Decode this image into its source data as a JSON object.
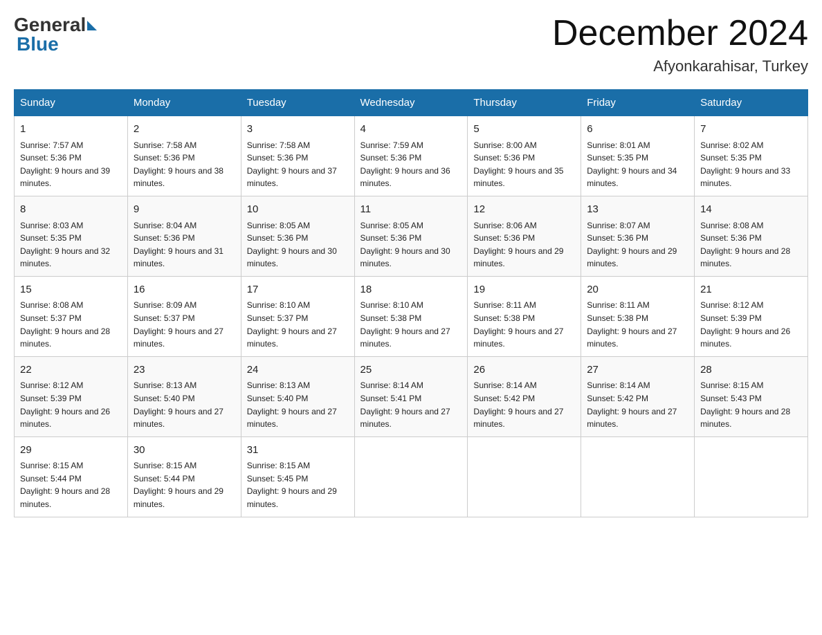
{
  "header": {
    "logo_general": "General",
    "logo_blue": "Blue",
    "month_year": "December 2024",
    "location": "Afyonkarahisar, Turkey"
  },
  "days_of_week": [
    "Sunday",
    "Monday",
    "Tuesday",
    "Wednesday",
    "Thursday",
    "Friday",
    "Saturday"
  ],
  "weeks": [
    [
      {
        "day": "1",
        "sunrise": "7:57 AM",
        "sunset": "5:36 PM",
        "daylight": "9 hours and 39 minutes."
      },
      {
        "day": "2",
        "sunrise": "7:58 AM",
        "sunset": "5:36 PM",
        "daylight": "9 hours and 38 minutes."
      },
      {
        "day": "3",
        "sunrise": "7:58 AM",
        "sunset": "5:36 PM",
        "daylight": "9 hours and 37 minutes."
      },
      {
        "day": "4",
        "sunrise": "7:59 AM",
        "sunset": "5:36 PM",
        "daylight": "9 hours and 36 minutes."
      },
      {
        "day": "5",
        "sunrise": "8:00 AM",
        "sunset": "5:36 PM",
        "daylight": "9 hours and 35 minutes."
      },
      {
        "day": "6",
        "sunrise": "8:01 AM",
        "sunset": "5:35 PM",
        "daylight": "9 hours and 34 minutes."
      },
      {
        "day": "7",
        "sunrise": "8:02 AM",
        "sunset": "5:35 PM",
        "daylight": "9 hours and 33 minutes."
      }
    ],
    [
      {
        "day": "8",
        "sunrise": "8:03 AM",
        "sunset": "5:35 PM",
        "daylight": "9 hours and 32 minutes."
      },
      {
        "day": "9",
        "sunrise": "8:04 AM",
        "sunset": "5:36 PM",
        "daylight": "9 hours and 31 minutes."
      },
      {
        "day": "10",
        "sunrise": "8:05 AM",
        "sunset": "5:36 PM",
        "daylight": "9 hours and 30 minutes."
      },
      {
        "day": "11",
        "sunrise": "8:05 AM",
        "sunset": "5:36 PM",
        "daylight": "9 hours and 30 minutes."
      },
      {
        "day": "12",
        "sunrise": "8:06 AM",
        "sunset": "5:36 PM",
        "daylight": "9 hours and 29 minutes."
      },
      {
        "day": "13",
        "sunrise": "8:07 AM",
        "sunset": "5:36 PM",
        "daylight": "9 hours and 29 minutes."
      },
      {
        "day": "14",
        "sunrise": "8:08 AM",
        "sunset": "5:36 PM",
        "daylight": "9 hours and 28 minutes."
      }
    ],
    [
      {
        "day": "15",
        "sunrise": "8:08 AM",
        "sunset": "5:37 PM",
        "daylight": "9 hours and 28 minutes."
      },
      {
        "day": "16",
        "sunrise": "8:09 AM",
        "sunset": "5:37 PM",
        "daylight": "9 hours and 27 minutes."
      },
      {
        "day": "17",
        "sunrise": "8:10 AM",
        "sunset": "5:37 PM",
        "daylight": "9 hours and 27 minutes."
      },
      {
        "day": "18",
        "sunrise": "8:10 AM",
        "sunset": "5:38 PM",
        "daylight": "9 hours and 27 minutes."
      },
      {
        "day": "19",
        "sunrise": "8:11 AM",
        "sunset": "5:38 PM",
        "daylight": "9 hours and 27 minutes."
      },
      {
        "day": "20",
        "sunrise": "8:11 AM",
        "sunset": "5:38 PM",
        "daylight": "9 hours and 27 minutes."
      },
      {
        "day": "21",
        "sunrise": "8:12 AM",
        "sunset": "5:39 PM",
        "daylight": "9 hours and 26 minutes."
      }
    ],
    [
      {
        "day": "22",
        "sunrise": "8:12 AM",
        "sunset": "5:39 PM",
        "daylight": "9 hours and 26 minutes."
      },
      {
        "day": "23",
        "sunrise": "8:13 AM",
        "sunset": "5:40 PM",
        "daylight": "9 hours and 27 minutes."
      },
      {
        "day": "24",
        "sunrise": "8:13 AM",
        "sunset": "5:40 PM",
        "daylight": "9 hours and 27 minutes."
      },
      {
        "day": "25",
        "sunrise": "8:14 AM",
        "sunset": "5:41 PM",
        "daylight": "9 hours and 27 minutes."
      },
      {
        "day": "26",
        "sunrise": "8:14 AM",
        "sunset": "5:42 PM",
        "daylight": "9 hours and 27 minutes."
      },
      {
        "day": "27",
        "sunrise": "8:14 AM",
        "sunset": "5:42 PM",
        "daylight": "9 hours and 27 minutes."
      },
      {
        "day": "28",
        "sunrise": "8:15 AM",
        "sunset": "5:43 PM",
        "daylight": "9 hours and 28 minutes."
      }
    ],
    [
      {
        "day": "29",
        "sunrise": "8:15 AM",
        "sunset": "5:44 PM",
        "daylight": "9 hours and 28 minutes."
      },
      {
        "day": "30",
        "sunrise": "8:15 AM",
        "sunset": "5:44 PM",
        "daylight": "9 hours and 29 minutes."
      },
      {
        "day": "31",
        "sunrise": "8:15 AM",
        "sunset": "5:45 PM",
        "daylight": "9 hours and 29 minutes."
      },
      null,
      null,
      null,
      null
    ]
  ]
}
